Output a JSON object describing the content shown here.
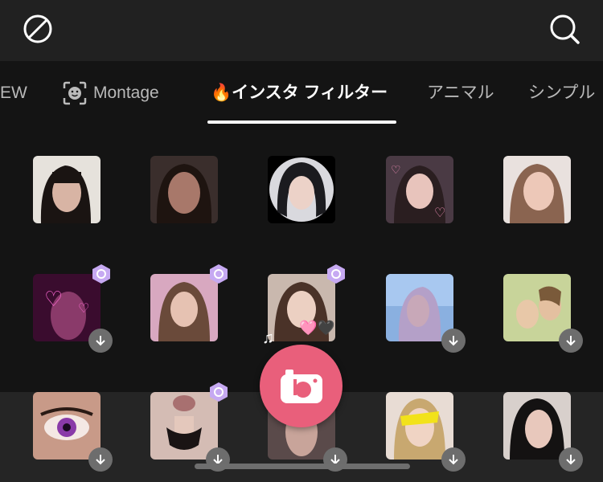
{
  "header": {
    "left_icon": "no-filter-icon",
    "right_icon": "search-icon"
  },
  "tabs": [
    {
      "label": "EW"
    },
    {
      "label": "Montage",
      "icon": "face-scan-icon"
    },
    {
      "label": "🔥インスタ フィルター",
      "active": true
    },
    {
      "label": "アニマル"
    },
    {
      "label": "シンプル"
    }
  ],
  "decorations": {
    "music_note": "♫",
    "hearts": "🩷🖤"
  },
  "colors": {
    "accent": "#e95f7b",
    "tab_underline": "#ffffff",
    "background": "#141414"
  },
  "bottom": {
    "camera_icon": "camera-icon"
  }
}
